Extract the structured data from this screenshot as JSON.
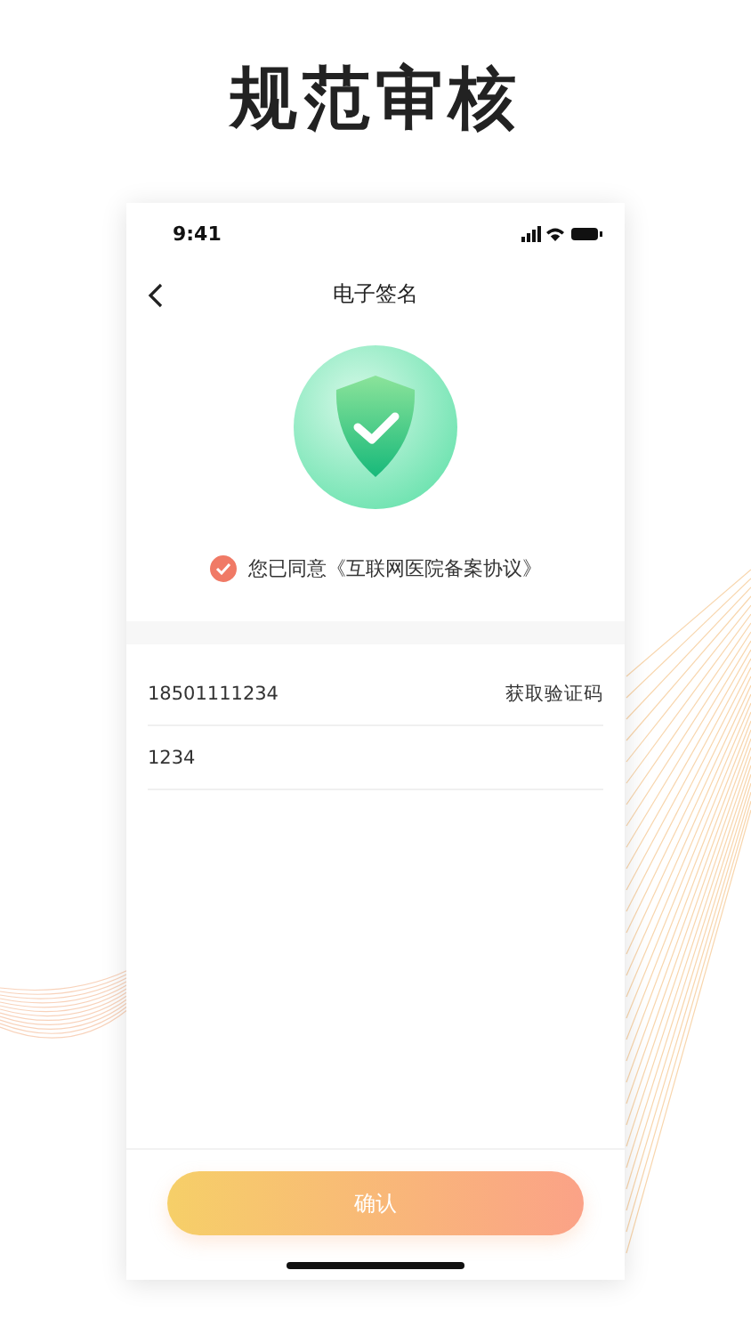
{
  "headline": "规范审核",
  "status_bar": {
    "time": "9:41"
  },
  "nav": {
    "title": "电子签名"
  },
  "agreement": {
    "checked": true,
    "text": "您已同意《互联网医院备案协议》"
  },
  "form": {
    "phone": {
      "value": "18501111234",
      "action": "获取验证码"
    },
    "code": {
      "value": "1234"
    }
  },
  "confirm_button": {
    "label": "确认"
  }
}
